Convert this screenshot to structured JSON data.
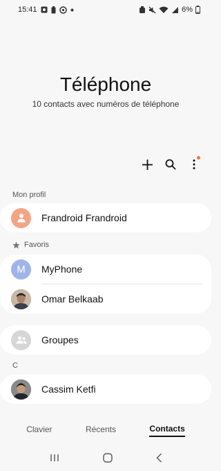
{
  "status_bar": {
    "time": "15:41",
    "battery": "6%"
  },
  "header": {
    "title": "Téléphone",
    "subtitle": "10 contacts avec numéros de téléphone"
  },
  "toolbar": {
    "add_icon": "plus-icon",
    "search_icon": "search-icon",
    "more_icon": "more-vertical-icon",
    "notification_color": "#f07a3b"
  },
  "sections": {
    "profile_label": "Mon profil",
    "favorites_label": "Favoris",
    "c_label": "C"
  },
  "profile": {
    "name": "Frandroid Frandroid",
    "avatar_color": "#f2a585"
  },
  "favorites": [
    {
      "name": "MyPhone",
      "initial": "M",
      "avatar_color": "#9fb5e8"
    },
    {
      "name": "Omar Belkaab",
      "avatar_color": "#6b5a4e"
    }
  ],
  "groups": {
    "label": "Groupes",
    "avatar_color": "#d6d6d6"
  },
  "contacts_c": [
    {
      "name": "Cassim Ketfi",
      "avatar_color": "#4b4440"
    }
  ],
  "tabs": [
    {
      "label": "Clavier",
      "active": false
    },
    {
      "label": "Récents",
      "active": false
    },
    {
      "label": "Contacts",
      "active": true
    }
  ]
}
